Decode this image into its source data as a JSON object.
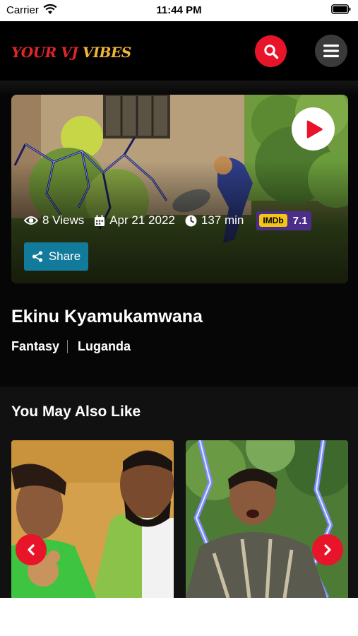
{
  "status_bar": {
    "carrier": "Carrier",
    "time": "11:44 PM"
  },
  "header": {
    "logo_part1": "YOUR VJ",
    "logo_part2": "VIBES",
    "search_icon": "search-icon",
    "menu_icon": "hamburger-menu-icon"
  },
  "movie": {
    "views": "8 Views",
    "date": "Apr 21 2022",
    "duration": "137 min",
    "imdb_label": "IMDb",
    "imdb_rating": "7.1",
    "share_label": "Share",
    "title": "Ekinu Kyamukamwana",
    "genre": "Fantasy",
    "language": "Luganda"
  },
  "recommendations": {
    "title": "You May Also Like"
  },
  "colors": {
    "accent_red": "#e8142a",
    "share_blue": "#127b9c",
    "imdb_purple": "#4b2d8a",
    "imdb_yellow": "#f5c518",
    "background": "#060606"
  }
}
